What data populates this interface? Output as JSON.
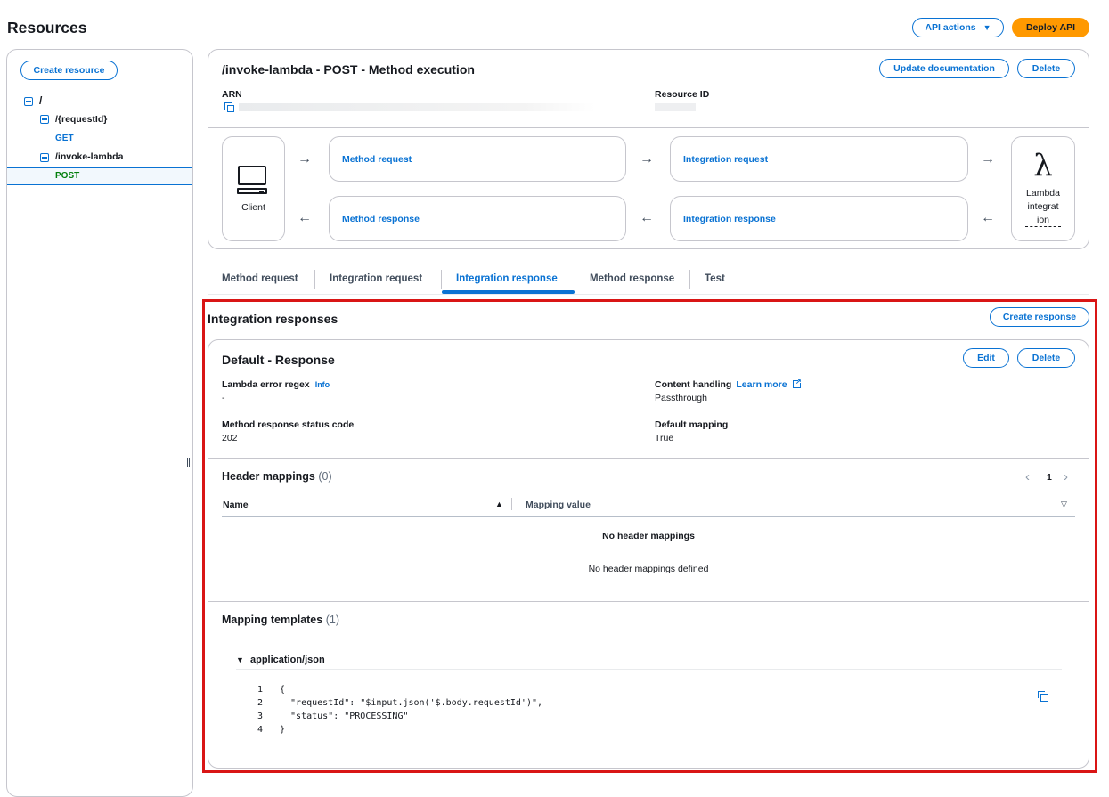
{
  "header": {
    "title": "Resources",
    "api_actions_label": "API actions",
    "deploy_label": "Deploy API"
  },
  "sidebar": {
    "create_resource_label": "Create resource",
    "tree": {
      "root": "/",
      "request_id": "/{requestId}",
      "get": "GET",
      "invoke_lambda": "/invoke-lambda",
      "post": "POST"
    }
  },
  "method": {
    "title": "/invoke-lambda - POST - Method execution",
    "update_doc_label": "Update documentation",
    "delete_label": "Delete",
    "arn_label": "ARN",
    "resource_id_label": "Resource ID"
  },
  "flow": {
    "client_label": "Client",
    "method_request": "Method request",
    "integration_request": "Integration request",
    "method_response": "Method response",
    "integration_response": "Integration response",
    "lambda_label_1": "Lambda",
    "lambda_label_2": "integrat",
    "lambda_label_3": "ion"
  },
  "tabs": [
    {
      "label": "Method request"
    },
    {
      "label": "Integration request"
    },
    {
      "label": "Integration response"
    },
    {
      "label": "Method response"
    },
    {
      "label": "Test"
    }
  ],
  "integration": {
    "title": "Integration responses",
    "create_response_label": "Create response",
    "default": {
      "title": "Default - Response",
      "edit_label": "Edit",
      "delete_label": "Delete",
      "lambda_regex_label": "Lambda error regex",
      "info_label": "Info",
      "lambda_regex_value": "-",
      "content_handling_label": "Content handling",
      "learn_more_label": "Learn more",
      "content_handling_value": "Passthrough",
      "status_code_label": "Method response status code",
      "status_code_value": "202",
      "default_mapping_label": "Default mapping",
      "default_mapping_value": "True"
    },
    "header_mappings": {
      "title": "Header mappings",
      "count": "(0)",
      "page": "1",
      "col_name": "Name",
      "col_value": "Mapping value",
      "empty_title": "No header mappings",
      "empty_desc": "No header mappings defined"
    },
    "mapping_templates": {
      "title": "Mapping templates",
      "count": "(1)",
      "content_type": "application/json",
      "lines": [
        {
          "n": "1",
          "text": "{"
        },
        {
          "n": "2",
          "text": "  \"requestId\": \"$input.json('$.body.requestId')\","
        },
        {
          "n": "3",
          "text": "  \"status\": \"PROCESSING\""
        },
        {
          "n": "4",
          "text": "}"
        }
      ]
    }
  },
  "colors": {
    "accent": "#0972d3",
    "deploy": "#ff9900",
    "highlight": "#d91515",
    "active_tree": "#037f0c"
  }
}
